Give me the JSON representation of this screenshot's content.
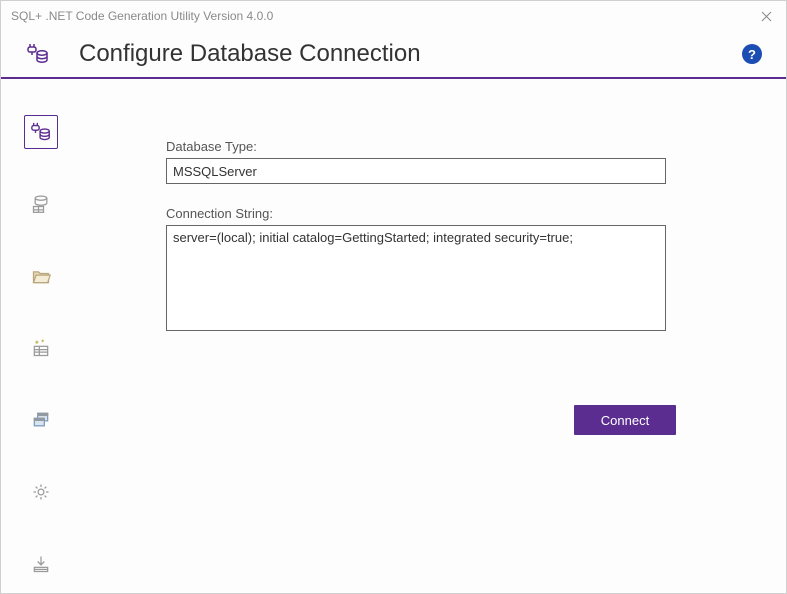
{
  "window": {
    "title": "SQL+ .NET Code Generation Utility Version 4.0.0"
  },
  "header": {
    "title": "Configure Database Connection"
  },
  "form": {
    "database_type_label": "Database Type:",
    "database_type_value": "MSSQLServer",
    "connection_string_label": "Connection String:",
    "connection_string_value": "server=(local); initial catalog=GettingStarted; integrated security=true;",
    "connect_button_label": "Connect"
  },
  "help": {
    "symbol": "?"
  },
  "colors": {
    "accent": "#5b2d90"
  }
}
